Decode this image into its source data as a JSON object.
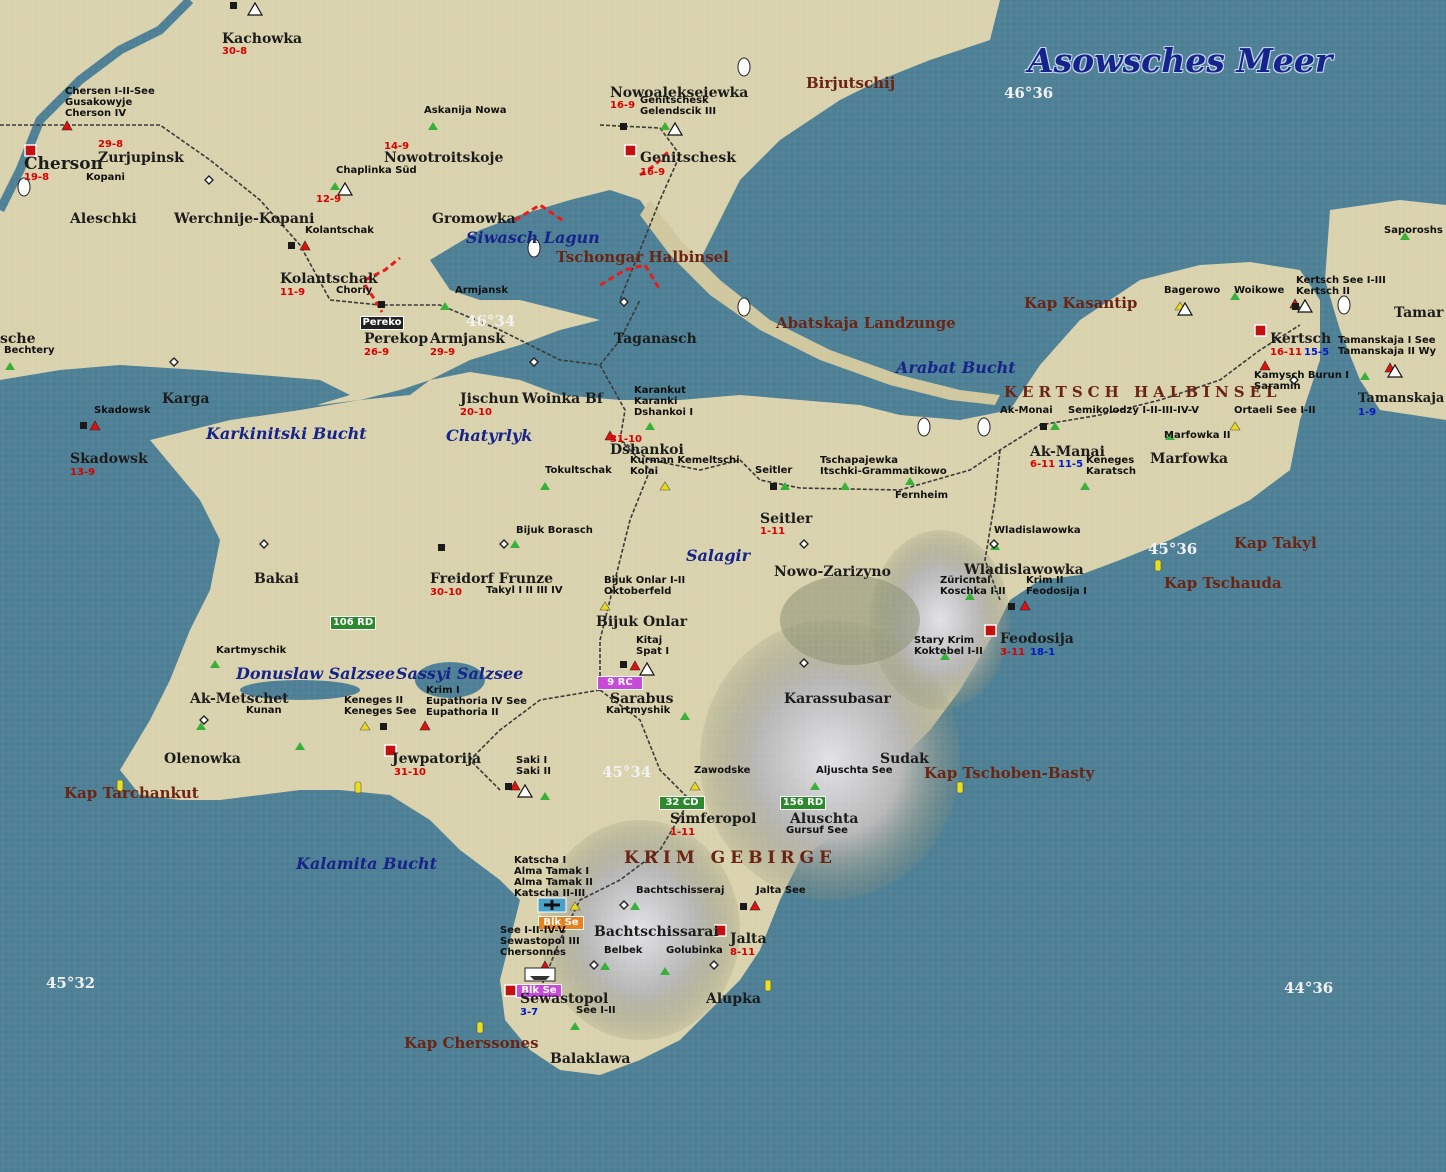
{
  "map_title": "Asowsches Meer",
  "seas": [
    "Siwasch Lagun",
    "Karkinitski Bucht",
    "Chatyrlyk",
    "Arabat Bucht",
    "Salagir",
    "Donuslaw Salzsee",
    "Sassyi Salzsee",
    "Kalamita Bucht"
  ],
  "features": [
    "Birjutschij",
    "Tschongar Halbinsel",
    "Abatskaja Landzunge",
    "Kap Kasantip",
    "Kap Takyl",
    "Kap Tschauda",
    "Kap Tschoben-Basty",
    "Kap Tarchankut",
    "Kap Cherssones"
  ],
  "ranges": [
    "KERTSCH HALBINSEL",
    "KRIM GEBIRGE"
  ],
  "coords": [
    "46°36",
    "46°34",
    "45°36",
    "45°34",
    "45°32",
    "44°36"
  ],
  "towns": [
    "Kachowka",
    "Nowoalekseiewka",
    "Cherson",
    "Zurjupinsk",
    "Nowotroitskoje",
    "Genitschesk",
    "Aleschki",
    "Werchnije-Kopani",
    "Gromowka",
    "Kolantschak",
    "Perekop",
    "Armjansk",
    "Taganasch",
    "Karga",
    "Jischun",
    "Woinka Bf",
    "Skadowsk",
    "Dshankoi",
    "Ak-Manai",
    "Marfowka",
    "Seitler",
    "Bakai",
    "Freidorf Frunze",
    "Nowo-Zarizyno",
    "Wladislawowka",
    "Bijuk Onlar",
    "Feodosija",
    "Ak-Metschet",
    "Sarabus",
    "Karassubasar",
    "Olenowka",
    "Jewpatorija",
    "Sudak",
    "Simferopol",
    "Aluschta",
    "Bachtschissarai",
    "Jalta",
    "Sewastopol",
    "Alupka",
    "Balaklawa",
    "Kertsch",
    "Tamanskaja",
    "Tamar",
    "sche"
  ],
  "small_labels": [
    "Chersen I-II-See",
    "Gusakowyje",
    "Cherson IV",
    "Kopani",
    "Askanija Nowa",
    "Chaplinka Süd",
    "Genitschesk",
    "Gelendscik III",
    "Kolantschak",
    "Choriy",
    "Armjansk",
    "Bechtery",
    "Skadowsk",
    "Karankut",
    "Karanki",
    "Dshankoi I",
    "Kurman Kemeltschi",
    "Kolai",
    "Tokultschak",
    "Seitler",
    "Tschapajewka",
    "Itschki-Grammatikowo",
    "Fernheim",
    "Ak-Monai",
    "Semikolodzy I-II-III-IV-V",
    "Keneges",
    "Karatsch",
    "Marfowka II",
    "Ortaeli See I-II",
    "Bagerowo",
    "Woikowe",
    "Kertsch See I-III",
    "Kertsch II",
    "Saporoshs",
    "Tamanskaja I See",
    "Tamanskaja II",
    "Wy",
    "Kamysch Burun I",
    "Saramin",
    "Bijuk Borasch",
    "Wladislawowka",
    "Takyl I II III IV",
    "Bijuk Onlar I-II",
    "Oktoberfeld",
    "Züricntal",
    "Koschka I-II",
    "Krim II",
    "Feodosija I",
    "Kartmyschik",
    "Kitaj",
    "Spat I",
    "Stary Krim",
    "Koktebel I-II",
    "Keneges II",
    "Keneges See",
    "Krim I",
    "Eupathoria IV See",
    "Eupathoria II",
    "Kunan",
    "Kartmyshik",
    "Saki I",
    "Saki II",
    "Zawodske",
    "Aljuschta See",
    "Gursuf See",
    "Katscha I",
    "Alma Tamak I",
    "Alma Tamak II",
    "Katscha II-III",
    "Bachtschisseraj",
    "Jalta See",
    "See I-II-IV-V",
    "Sewastopol III",
    "Chersonnes",
    "Belbek",
    "Golubinka",
    "See I-II"
  ],
  "red_values": [
    "30-8",
    "16-9",
    "29-8",
    "19-8",
    "14-9",
    "16-9",
    "12-9",
    "11-9",
    "26-9",
    "29-9",
    "20-10",
    "13-9",
    "31-10",
    "6-11",
    "16-11",
    "1-11",
    "30-10",
    "3-11",
    "31-10",
    "1-11",
    "8-11"
  ],
  "blue_values": [
    "11-5",
    "15-5",
    "1-9",
    "18-1",
    "3-7"
  ],
  "units": [
    {
      "label": "Pereko",
      "color": "#e8e8e8"
    },
    {
      "label": "106 RD",
      "color": "#2c8a2c"
    },
    {
      "label": "9 RC",
      "color": "#c84ad8"
    },
    {
      "label": "32 CD",
      "color": "#2c8a2c"
    },
    {
      "label": "156 RD",
      "color": "#2c8a2c"
    },
    {
      "label": "Blk Se",
      "color": "#e8821e"
    },
    {
      "label": "Blk Se",
      "color": "#c84ad8"
    }
  ],
  "icons": [
    "airfield-icon",
    "port-icon",
    "fuel-icon",
    "city-icon",
    "ship-icon",
    "buoy-icon"
  ],
  "colors": {
    "sea": "#4d7f95",
    "land": "#d9d2ad",
    "mountain": "#7a806a",
    "front": "#e81c1c",
    "rail": "#3a3a3a"
  }
}
